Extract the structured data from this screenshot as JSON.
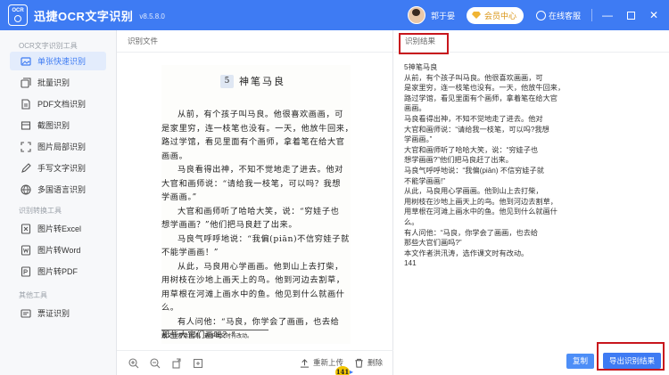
{
  "app": {
    "logo_text": "OCR",
    "title": "迅捷OCR文字识别",
    "version": "v8.5.8.0",
    "username": "郭于晏",
    "vip_label": "会员中心",
    "service_label": "在线客服",
    "window_controls": [
      "minimize",
      "maximize",
      "close"
    ]
  },
  "sidebar": {
    "groups": [
      {
        "title": "OCR文字识别工具",
        "items": [
          {
            "label": "单张快速识别",
            "icon": "image-icon",
            "active": true
          },
          {
            "label": "批量识别",
            "icon": "layers-icon",
            "active": false
          },
          {
            "label": "PDF文档识别",
            "icon": "document-icon",
            "active": false
          },
          {
            "label": "截图识别",
            "icon": "crop-icon",
            "active": false
          },
          {
            "label": "图片局部识别",
            "icon": "partial-icon",
            "active": false
          },
          {
            "label": "手写文字识别",
            "icon": "pen-icon",
            "active": false
          },
          {
            "label": "多国语言识别",
            "icon": "globe-icon",
            "active": false
          }
        ]
      },
      {
        "title": "识别转换工具",
        "items": [
          {
            "label": "图片转Excel",
            "icon": "excel-icon",
            "active": false
          },
          {
            "label": "图片转Word",
            "icon": "word-icon",
            "active": false
          },
          {
            "label": "图片转PDF",
            "icon": "pdf-icon",
            "active": false
          }
        ]
      },
      {
        "title": "其他工具",
        "items": [
          {
            "label": "票证识别",
            "icon": "ticket-icon",
            "active": false
          }
        ]
      }
    ]
  },
  "source_panel": {
    "header": "识别文件",
    "document": {
      "lesson_number": "5",
      "title": "神笔马良",
      "lines": [
        "从前，有个孩子叫马良。他很喜欢画画，可",
        "是家里穷，连一枝笔也没有。一天，他放牛回来，",
        "路过学馆，看见里面有个画师，拿着笔在给大官",
        "画画。",
        "马良看得出神，不知不觉地走了进去。他对",
        "大官和画师说：“请给我一枝笔，可以吗？我想",
        "学画画。”",
        "大官和画师听了哈哈大笑，说：“穷娃子也",
        "想学画画？”他们把马良赶了出来。",
        "马良气呼呼地说：“我偏(piān)不信穷娃子就",
        "不能学画画！”",
        "从此，马良用心学画画。他到山上去打柴，",
        "用树枝在沙地上画天上的鸟。他到河边去割草，",
        "用草根在河滩上画水中的鱼。他见到什么就画什",
        "么。",
        "有人问他：“马良，你学会了画画，也去给",
        "那些大官们画吗？”"
      ],
      "footnote": "本文作者洪汛涛，选作课文时有改动。",
      "page_number": "141"
    },
    "toolbar": {
      "zoom_in": "zoom-in-icon",
      "zoom_out": "zoom-out-icon",
      "rotate": "rotate-icon",
      "fit": "fit-icon",
      "reupload_label": "重新上传",
      "delete_label": "删除"
    }
  },
  "result_panel": {
    "header": "识别结果",
    "lines": [
      "5神笔马良",
      "从前，有个孩子叫马良。他很喜欢画画，可",
      "是家里穷，连一枝笔也没有。一天，他放牛回来，",
      "路过学馆，看见里面有个画师，拿着笔在给大官",
      "画画。",
      "马良看得出神，不知不觉地走了进去。他对",
      "大官和画师说：“请给我一枝笔，可以吗?我想",
      "学画画。”",
      "大官和画师听了哈哈大笑，说：“穷娃子也",
      "想学画画?”他们把马良赶了出来。",
      "马良气呼呼地说：“我偏(piān) 不信穷娃子就",
      "不能学画画!”",
      "从此，马良用心学画画。他到山上去打柴，",
      "用树枝在沙地上画天上的鸟。他到河边去割草，",
      "用草根在河滩上画水中的鱼。他见到什么就画什",
      "么。",
      "有人问他：“马良，你学会了画画，也去给",
      "那些大官们画吗?”",
      "本文作者洪汛涛，选作课文时有改动。",
      "141"
    ],
    "copy_label": "复制",
    "export_label": "导出识别结果"
  },
  "colors": {
    "brand": "#3e7bf3",
    "active_bg": "#e3ecfc",
    "highlight": "#c8161d",
    "vip_text": "#d99413"
  }
}
